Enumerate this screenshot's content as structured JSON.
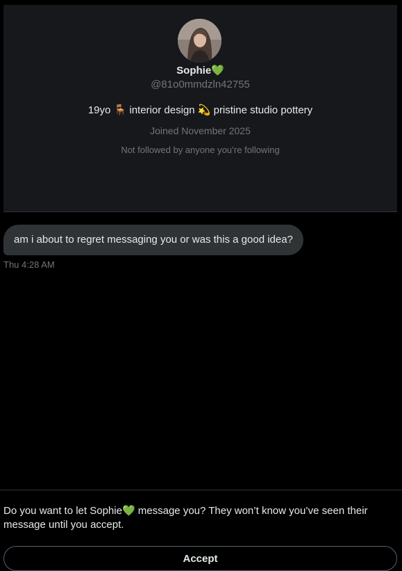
{
  "profile": {
    "display_name": "Sophie💚",
    "handle": "@81o0mmdzln42755",
    "bio": "19yo 🪑 interior design 💫 pristine studio pottery",
    "joined": "Joined November 2025",
    "followed_note": "Not followed by anyone you’re following"
  },
  "conversation": {
    "messages": [
      {
        "text": "am i about to regret messaging you or was this a good idea?",
        "time": "Thu 4:28 AM"
      }
    ]
  },
  "request": {
    "prompt": "Do you want to let Sophie💚 message you? They won’t know you’ve seen their message until you accept.",
    "accept_label": "Accept"
  },
  "colors": {
    "background": "#000000",
    "card": "#16181c",
    "bubble": "#2f3336",
    "muted_text": "#71767b",
    "text": "#e7e9ea"
  }
}
